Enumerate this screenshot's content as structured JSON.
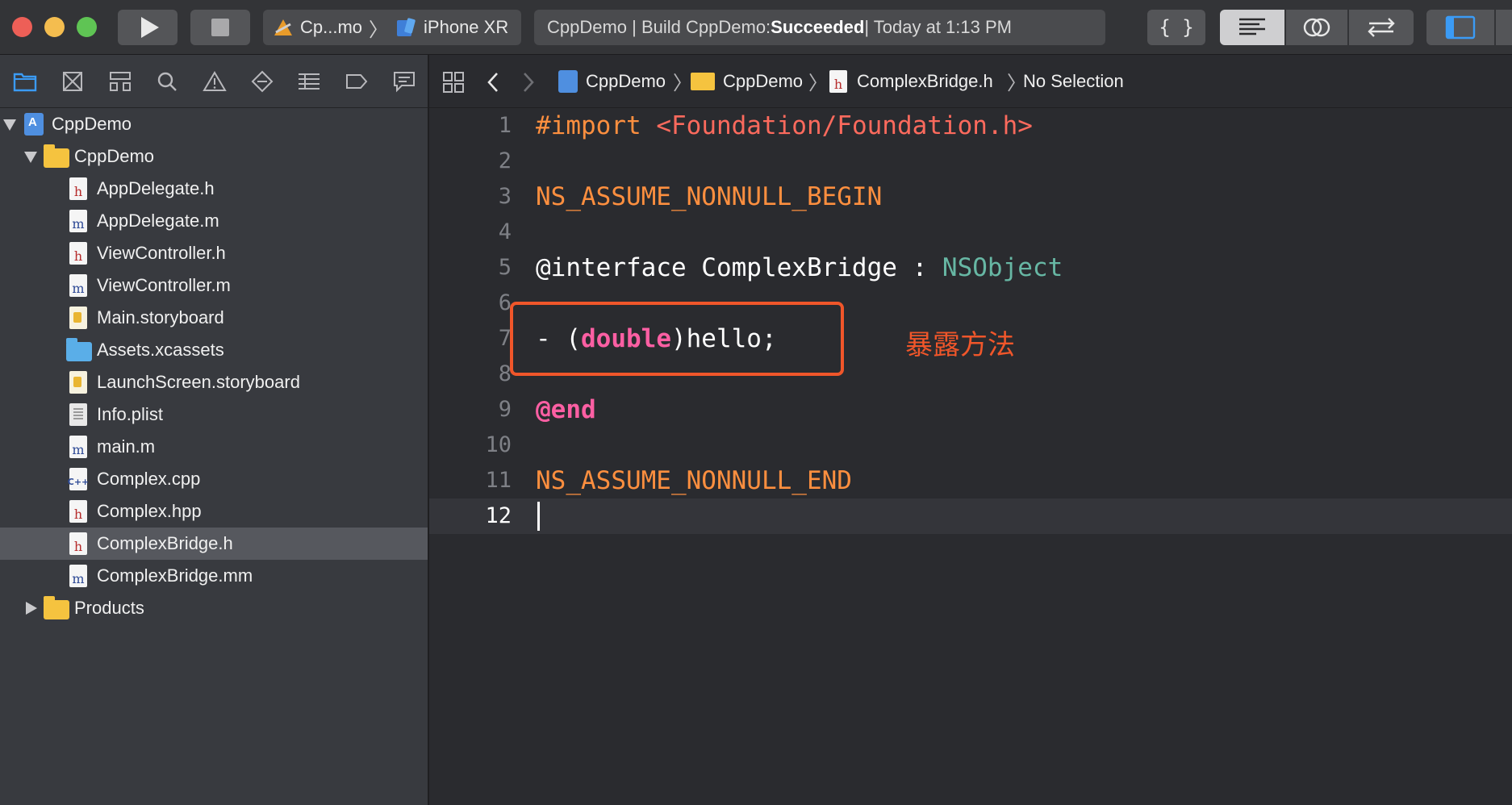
{
  "toolbar": {
    "scheme": "Cp...mo",
    "device": "iPhone XR",
    "status_prefix": "CppDemo | Build CppDemo: ",
    "status_result": "Succeeded",
    "status_suffix": " | Today at 1:13 PM"
  },
  "navigator": {
    "items": [
      {
        "label": "CppDemo",
        "kind": "project"
      },
      {
        "label": "CppDemo",
        "kind": "folder"
      },
      {
        "label": "AppDelegate.h",
        "kind": "h"
      },
      {
        "label": "AppDelegate.m",
        "kind": "m"
      },
      {
        "label": "ViewController.h",
        "kind": "h"
      },
      {
        "label": "ViewController.m",
        "kind": "m"
      },
      {
        "label": "Main.storyboard",
        "kind": "storyboard"
      },
      {
        "label": "Assets.xcassets",
        "kind": "assets"
      },
      {
        "label": "LaunchScreen.storyboard",
        "kind": "storyboard"
      },
      {
        "label": "Info.plist",
        "kind": "plist"
      },
      {
        "label": "main.m",
        "kind": "m"
      },
      {
        "label": "Complex.cpp",
        "kind": "cpp"
      },
      {
        "label": "Complex.hpp",
        "kind": "h"
      },
      {
        "label": "ComplexBridge.h",
        "kind": "h",
        "selected": true
      },
      {
        "label": "ComplexBridge.mm",
        "kind": "m"
      },
      {
        "label": "Products",
        "kind": "folder"
      }
    ]
  },
  "jumpbar": {
    "project": "CppDemo",
    "group": "CppDemo",
    "file": "ComplexBridge.h",
    "selection": "No Selection"
  },
  "editor": {
    "line_numbers": [
      "1",
      "2",
      "3",
      "4",
      "5",
      "6",
      "7",
      "8",
      "9",
      "10",
      "11",
      "12"
    ],
    "current_line": 12,
    "code": {
      "l1_directive": "#import",
      "l1_header": "<Foundation/Foundation.h>",
      "l3": "NS_ASSUME_NONNULL_BEGIN",
      "l5_decl": "@interface ComplexBridge : ",
      "l5_super": "NSObject",
      "l7_start": "- (",
      "l7_type": "double",
      "l7_end": ")hello;",
      "l9": "@end",
      "l11": "NS_ASSUME_NONNULL_END"
    },
    "annotation": "暴露方法"
  },
  "colors": {
    "annotation": "#f0562a",
    "keyword": "#fc5fa3",
    "preprocessor": "#fd8f3f",
    "string": "#fc6a5d",
    "class": "#67b7a4",
    "accent": "#3b9bf5"
  },
  "icons": {
    "nav_tabs": [
      "folder-icon",
      "source-control-icon",
      "symbol-icon",
      "search-icon",
      "issue-icon",
      "test-icon",
      "debug-icon",
      "breakpoint-icon",
      "report-icon"
    ]
  }
}
